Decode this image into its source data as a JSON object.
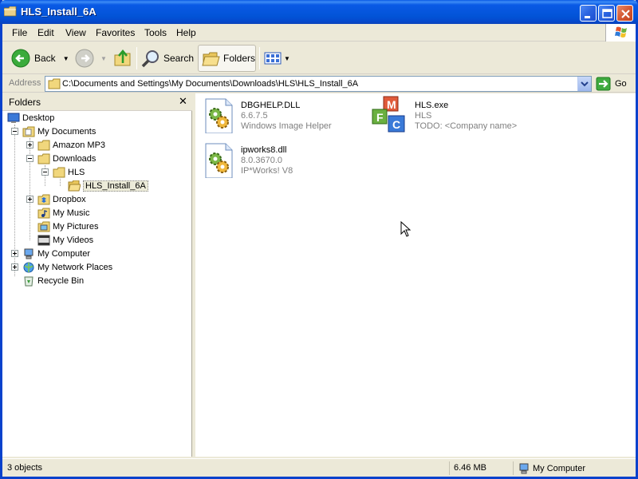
{
  "window": {
    "title": "HLS_Install_6A",
    "colors": {
      "titlebar": "#0a5ae6",
      "frame": "#0842cc",
      "close_button": "#d55a34",
      "panel": "#ece9d8"
    }
  },
  "menu": {
    "items": [
      "File",
      "Edit",
      "View",
      "Favorites",
      "Tools",
      "Help"
    ]
  },
  "toolbar": {
    "back_label": "Back",
    "search_label": "Search",
    "folders_label": "Folders",
    "icons": [
      "back-arrow-icon",
      "forward-arrow-icon",
      "up-folder-icon",
      "search-icon",
      "folders-icon",
      "views-icon"
    ]
  },
  "address": {
    "label": "Address",
    "path": "C:\\Documents and Settings\\My Documents\\Downloads\\HLS\\HLS_Install_6A",
    "go_label": "Go"
  },
  "folders_pane": {
    "title": "Folders",
    "tree": [
      {
        "label": "Desktop",
        "icon": "desktop-icon"
      },
      {
        "label": "My Documents",
        "icon": "documents-folder-icon",
        "expanded": true
      },
      {
        "label": "Amazon MP3",
        "icon": "folder-icon",
        "expandable": true
      },
      {
        "label": "Downloads",
        "icon": "folder-icon",
        "expanded": true
      },
      {
        "label": "HLS",
        "icon": "folder-icon",
        "expanded": true
      },
      {
        "label": "HLS_Install_6A",
        "icon": "open-folder-icon",
        "selected": true
      },
      {
        "label": "Dropbox",
        "icon": "dropbox-folder-icon",
        "expandable": true
      },
      {
        "label": "My Music",
        "icon": "music-folder-icon"
      },
      {
        "label": "My Pictures",
        "icon": "pictures-folder-icon"
      },
      {
        "label": "My Videos",
        "icon": "videos-folder-icon"
      },
      {
        "label": "My Computer",
        "icon": "computer-icon",
        "expandable": true
      },
      {
        "label": "My Network Places",
        "icon": "network-icon",
        "expandable": true
      },
      {
        "label": "Recycle Bin",
        "icon": "recycle-bin-icon"
      }
    ]
  },
  "files": [
    {
      "name": "DBGHELP.DLL",
      "version": "6.6.7.5",
      "description": "Windows Image Helper",
      "icon": "dll-gear-icon"
    },
    {
      "name": "HLS.exe",
      "version": "HLS",
      "description": "TODO: <Company name>",
      "icon": "mfc-cubes-icon"
    },
    {
      "name": "ipworks8.dll",
      "version": "8.0.3670.0",
      "description": "IP*Works! V8",
      "icon": "dll-gear-icon"
    }
  ],
  "status": {
    "objects": "3 objects",
    "size": "6.46 MB",
    "zone": "My Computer"
  }
}
